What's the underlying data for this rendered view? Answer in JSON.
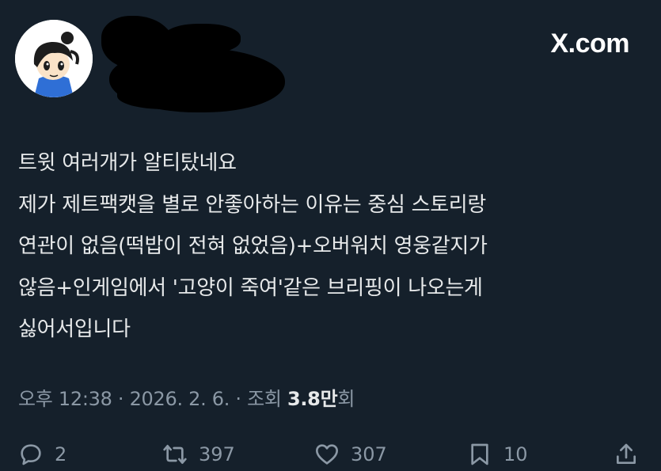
{
  "header": {
    "brand": "X.com"
  },
  "tweet": {
    "lines": [
      "트윗 여러개가 알티탔네요",
      "제가 제트팩캣을 별로 안좋아하는 이유는 중심 스토리랑",
      "연관이 없음(떡밥이 전혀 없었음)+오버워치 영웅같지가",
      "않음+인게임에서 '고양이 죽여'같은 브리핑이 나오는게",
      "싫어서입니다"
    ]
  },
  "meta": {
    "time": "오후 12:38",
    "date": "2026. 2. 6.",
    "views_label": "조회",
    "views_count": "3.8만",
    "views_suffix": "회"
  },
  "actions": {
    "reply_count": "2",
    "retweet_count": "397",
    "like_count": "307",
    "bookmark_count": "10"
  },
  "colors": {
    "background": "#15202b",
    "text": "#e7e9ea",
    "muted": "#8b98a5"
  }
}
